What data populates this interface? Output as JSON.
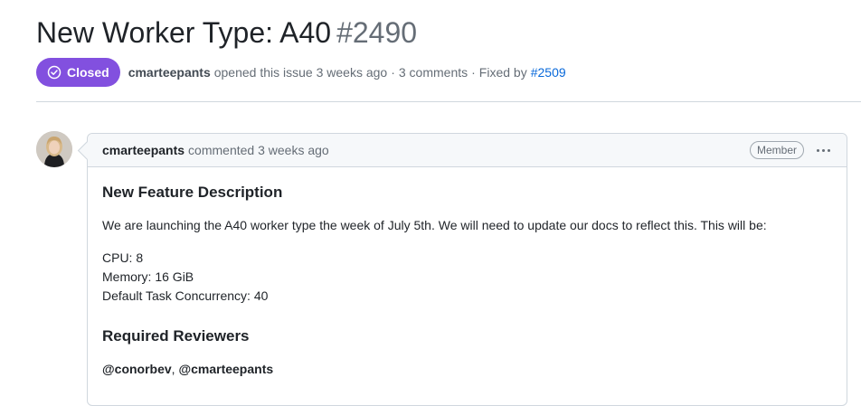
{
  "issue": {
    "title": "New Worker Type: A40",
    "number": "#2490",
    "state": "Closed",
    "author": "cmarteepants",
    "opened_text": "opened this issue 3 weeks ago",
    "comments_text": "3 comments",
    "fixed_by_label": "Fixed by",
    "fixed_by_link": "#2509",
    "separator": "·"
  },
  "colors": {
    "closed_badge": "#8250df",
    "link": "#0969da"
  },
  "comment": {
    "author": "cmarteepants",
    "action": "commented 3 weeks ago",
    "role_badge": "Member",
    "menu_icon": "kebab-horizontal-icon",
    "heading_1": "New Feature Description",
    "paragraph": "We are launching the A40 worker type the week of July 5th. We will need to update our docs to reflect this. This will be:",
    "specs": [
      "CPU: 8",
      "Memory: 16 GiB",
      "Default Task Concurrency: 40"
    ],
    "heading_2": "Required Reviewers",
    "reviewer_1": "@conorbev",
    "reviewer_sep": ", ",
    "reviewer_2": "@cmarteepants"
  }
}
